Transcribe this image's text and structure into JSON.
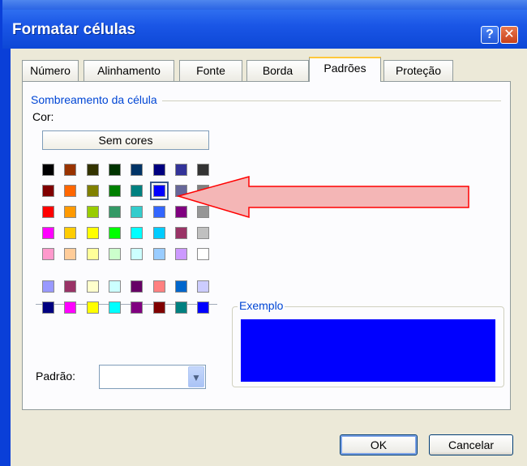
{
  "window": {
    "title": "Formatar células"
  },
  "titlebar": {
    "help_label": "?",
    "close_label": "✕"
  },
  "tabs": [
    {
      "label": "Número"
    },
    {
      "label": "Alinhamento"
    },
    {
      "label": "Fonte"
    },
    {
      "label": "Borda"
    },
    {
      "label": "Padrões",
      "active": true
    },
    {
      "label": "Proteção"
    }
  ],
  "shading": {
    "group_label": "Sombreamento da célula",
    "color_label": "Cor:",
    "no_color_button": "Sem cores",
    "palette_main": [
      [
        "#000000",
        "#993300",
        "#333300",
        "#003300",
        "#003366",
        "#000080",
        "#333399",
        "#333333"
      ],
      [
        "#800000",
        "#ff6600",
        "#808000",
        "#008000",
        "#008080",
        "#0000ff",
        "#666699",
        "#808080"
      ],
      [
        "#ff0000",
        "#ff9900",
        "#99cc00",
        "#339966",
        "#33cccc",
        "#3366ff",
        "#800080",
        "#969696"
      ],
      [
        "#ff00ff",
        "#ffcc00",
        "#ffff00",
        "#00ff00",
        "#00ffff",
        "#00ccff",
        "#993366",
        "#c0c0c0"
      ],
      [
        "#ff99cc",
        "#ffcc99",
        "#ffff99",
        "#ccffcc",
        "#ccffff",
        "#99ccff",
        "#cc99ff",
        "#ffffff"
      ]
    ],
    "palette_extra": [
      [
        "#9999ff",
        "#993366",
        "#ffffcc",
        "#ccffff",
        "#660066",
        "#ff8080",
        "#0066cc",
        "#ccccff"
      ],
      [
        "#000080",
        "#ff00ff",
        "#ffff00",
        "#00ffff",
        "#800080",
        "#800000",
        "#008080",
        "#0000ff"
      ]
    ],
    "selected_color": "#0000ff",
    "pattern_label": "Padrão:",
    "pattern_value": ""
  },
  "example": {
    "label": "Exemplo",
    "color": "#0000ff"
  },
  "buttons": {
    "ok": "OK",
    "cancel": "Cancelar"
  },
  "annotation": {
    "arrow_color": "#f4b6b6",
    "arrow_stroke": "#ff0000"
  }
}
